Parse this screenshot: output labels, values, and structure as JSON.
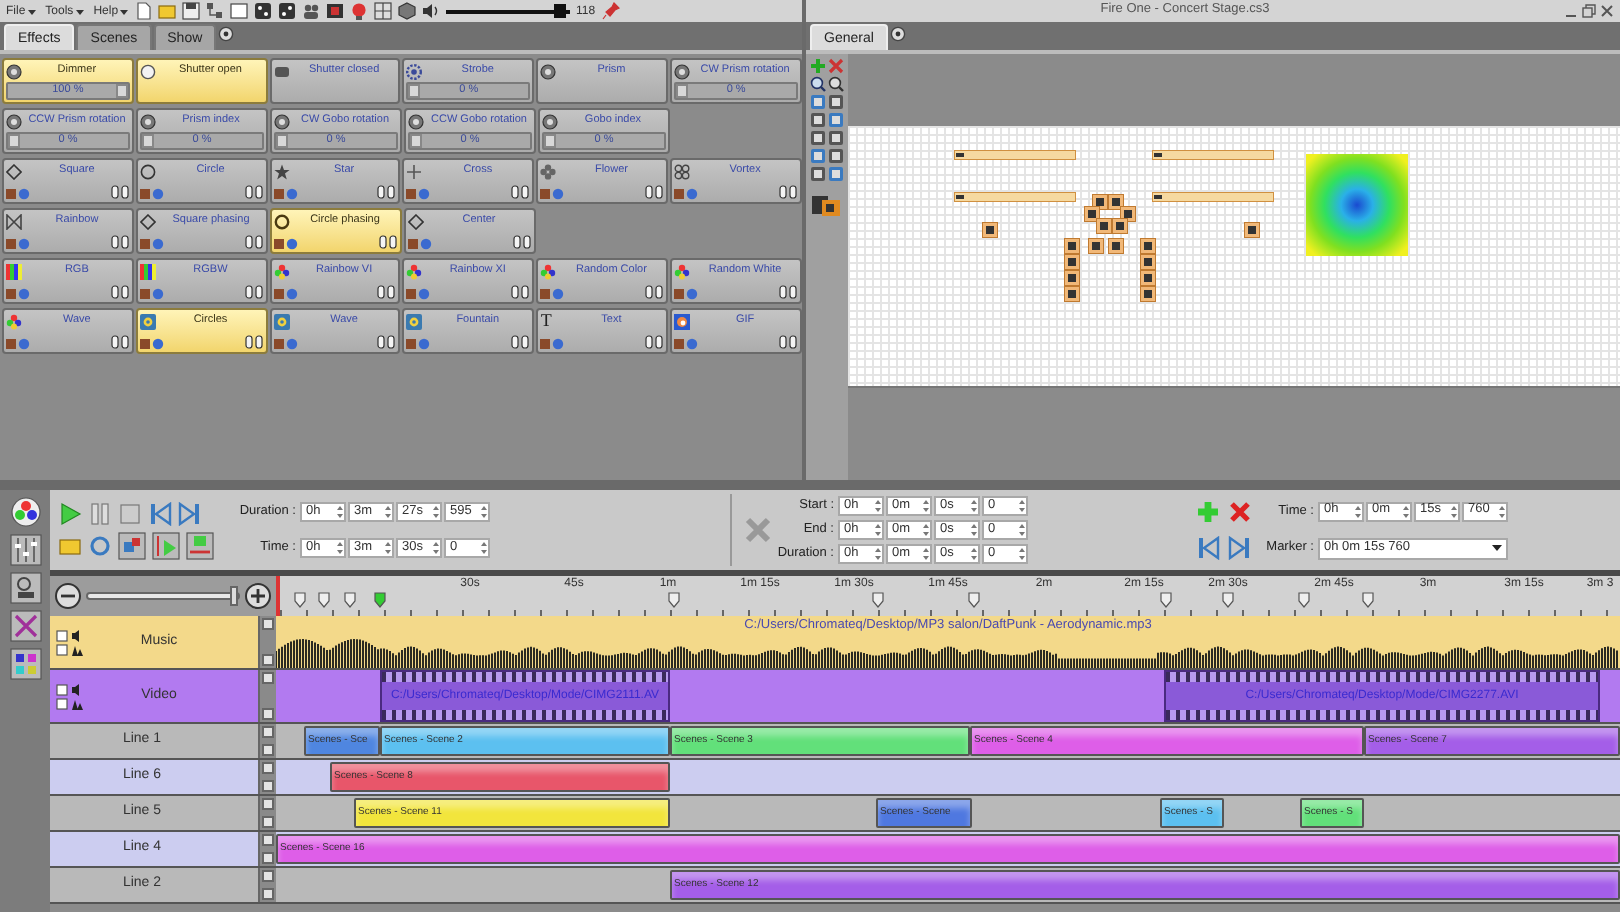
{
  "menu": [
    {
      "label": "File"
    },
    {
      "label": "Tools"
    },
    {
      "label": "Help"
    }
  ],
  "volume": {
    "level": 0.97,
    "reading": "118"
  },
  "window": {
    "title": "Fire One - Concert Stage.cs3"
  },
  "left_tabs": [
    {
      "label": "Effects",
      "selected": true
    },
    {
      "label": "Scenes",
      "selected": false
    },
    {
      "label": "Show",
      "selected": false
    }
  ],
  "effect_rows": [
    [
      {
        "label": "Dimmer",
        "kind": "slider",
        "selected": true,
        "level": 1,
        "reading": "100 %"
      },
      {
        "label": "Shutter open",
        "kind": "toggle",
        "selected": true
      },
      {
        "label": "Shutter closed",
        "kind": "toggle",
        "selected": false
      },
      {
        "label": "Strobe",
        "kind": "slider",
        "selected": false,
        "level": 0,
        "reading": "0 %"
      },
      {
        "label": "Prism",
        "kind": "toggle",
        "selected": false
      },
      {
        "label": "CW Prism rotation",
        "kind": "slider",
        "selected": false,
        "level": 0,
        "reading": "0 %"
      }
    ],
    [
      {
        "label": "CCW Prism rotation",
        "kind": "slider",
        "selected": false,
        "level": 0,
        "reading": "0 %"
      },
      {
        "label": "Prism index",
        "kind": "slider",
        "selected": false,
        "level": 0,
        "reading": "0 %"
      },
      {
        "label": "CW Gobo rotation",
        "kind": "slider",
        "selected": false,
        "level": 0,
        "reading": "0 %"
      },
      {
        "label": "CCW Gobo rotation",
        "kind": "slider",
        "selected": false,
        "level": 0,
        "reading": "0 %"
      },
      {
        "label": "Gobo index",
        "kind": "slider",
        "selected": false,
        "level": 0,
        "reading": "0 %"
      }
    ],
    [
      {
        "label": "Square",
        "kind": "effect",
        "selected": false
      },
      {
        "label": "Circle",
        "kind": "effect",
        "selected": false
      },
      {
        "label": "Star",
        "kind": "effect",
        "selected": false
      },
      {
        "label": "Cross",
        "kind": "effect",
        "selected": false
      },
      {
        "label": "Flower",
        "kind": "effect",
        "selected": false
      },
      {
        "label": "Vortex",
        "kind": "effect",
        "selected": false
      }
    ],
    [
      {
        "label": "Rainbow",
        "kind": "effect",
        "selected": false
      },
      {
        "label": "Square phasing",
        "kind": "effect",
        "selected": false
      },
      {
        "label": "Circle phasing",
        "kind": "effect",
        "selected": true
      },
      {
        "label": "Center",
        "kind": "effect",
        "selected": false
      }
    ],
    [
      {
        "label": "RGB",
        "kind": "effect",
        "selected": false
      },
      {
        "label": "RGBW",
        "kind": "effect",
        "selected": false
      },
      {
        "label": "Rainbow VI",
        "kind": "effect",
        "selected": false
      },
      {
        "label": "Rainbow XI",
        "kind": "effect",
        "selected": false
      },
      {
        "label": "Random Color",
        "kind": "effect",
        "selected": false
      },
      {
        "label": "Random White",
        "kind": "effect",
        "selected": false
      }
    ],
    [
      {
        "label": "Wave",
        "kind": "effect",
        "selected": false
      },
      {
        "label": "Circles",
        "kind": "effect",
        "selected": true
      },
      {
        "label": "Wave",
        "kind": "effect",
        "selected": false
      },
      {
        "label": "Fountain",
        "kind": "effect",
        "selected": false
      },
      {
        "label": "Text",
        "kind": "glyph",
        "glyph": "T",
        "selected": false
      },
      {
        "label": "GIF",
        "kind": "effect",
        "selected": false
      }
    ]
  ],
  "right_tabs": [
    {
      "label": "General",
      "selected": true
    }
  ],
  "transport": {
    "duration": {
      "label": "Duration :",
      "fields": [
        "0h",
        "3m",
        "27s",
        "595"
      ]
    },
    "time": {
      "label": "Time :",
      "fields": [
        "0h",
        "3m",
        "30s",
        "0"
      ]
    }
  },
  "clip_properties": [
    {
      "label": "Start :",
      "fields": [
        "0h",
        "0m",
        "0s",
        "0"
      ]
    },
    {
      "label": "End :",
      "fields": [
        "0h",
        "0m",
        "0s",
        "0"
      ]
    },
    {
      "label": "Duration :",
      "fields": [
        "0h",
        "0m",
        "0s",
        "0"
      ]
    }
  ],
  "cursor": {
    "label": "Time :",
    "fields": [
      "0h",
      "0m",
      "15s",
      "760"
    ]
  },
  "marker": {
    "label": "Marker :",
    "value": "0h 0m 15s 760"
  },
  "zoom": {
    "level": 1
  },
  "ruler": [
    "30s",
    "45s",
    "1m",
    "1m 15s",
    "1m 30s",
    "1m 45s",
    "2m",
    "2m 15s",
    "2m 30s",
    "2m 45s",
    "3m",
    "3m 15s",
    "3m 3"
  ],
  "tracks": [
    {
      "name": "Music",
      "kind": "audio",
      "clips": [
        {
          "label": "C:/Users/Chromateq/Desktop/MP3 salon/DaftPunk - Aerodynamic.mp3",
          "color": "#f3d98a"
        }
      ]
    },
    {
      "name": "Video",
      "kind": "video",
      "clips": [
        {
          "label": "C:/Users/Chromateq/Desktop/Mode/CIMG2111.AV",
          "color": "#8a5ad8"
        },
        {
          "label": "C:/Users/Chromateq/Desktop/Mode/CIMG2277.AVI",
          "color": "#8a5ad8"
        }
      ]
    },
    {
      "name": "Line 1",
      "kind": "line",
      "clips": [
        {
          "label": "Scenes - Sce",
          "color": "#4f86e0"
        },
        {
          "label": "Scenes - Scene 2",
          "color": "#5cc0f0"
        },
        {
          "label": "Scenes - Scene 3",
          "color": "#62e07a"
        },
        {
          "label": "Scenes - Scene 4",
          "color": "#de5ee8"
        },
        {
          "label": "Scenes - Scene 7",
          "color": "#a45ee8"
        }
      ]
    },
    {
      "name": "Line 6",
      "kind": "line",
      "clips": [
        {
          "label": "Scenes - Scene 8",
          "color": "#e8566a"
        }
      ]
    },
    {
      "name": "Line 5",
      "kind": "line",
      "clips": [
        {
          "label": "Scenes - Scene 11",
          "color": "#f2e53c"
        },
        {
          "label": "Scenes - Scene",
          "color": "#4f78e0"
        },
        {
          "label": "Scenes - S",
          "color": "#5cc0f0"
        },
        {
          "label": "Scenes - S",
          "color": "#62e07a"
        }
      ]
    },
    {
      "name": "Line 4",
      "kind": "line",
      "clips": [
        {
          "label": "Scenes - Scene 16",
          "color": "#de5ee8"
        }
      ]
    },
    {
      "name": "Line 2",
      "kind": "line",
      "clips": [
        {
          "label": "Scenes - Scene 12",
          "color": "#a45ee8"
        }
      ]
    }
  ]
}
